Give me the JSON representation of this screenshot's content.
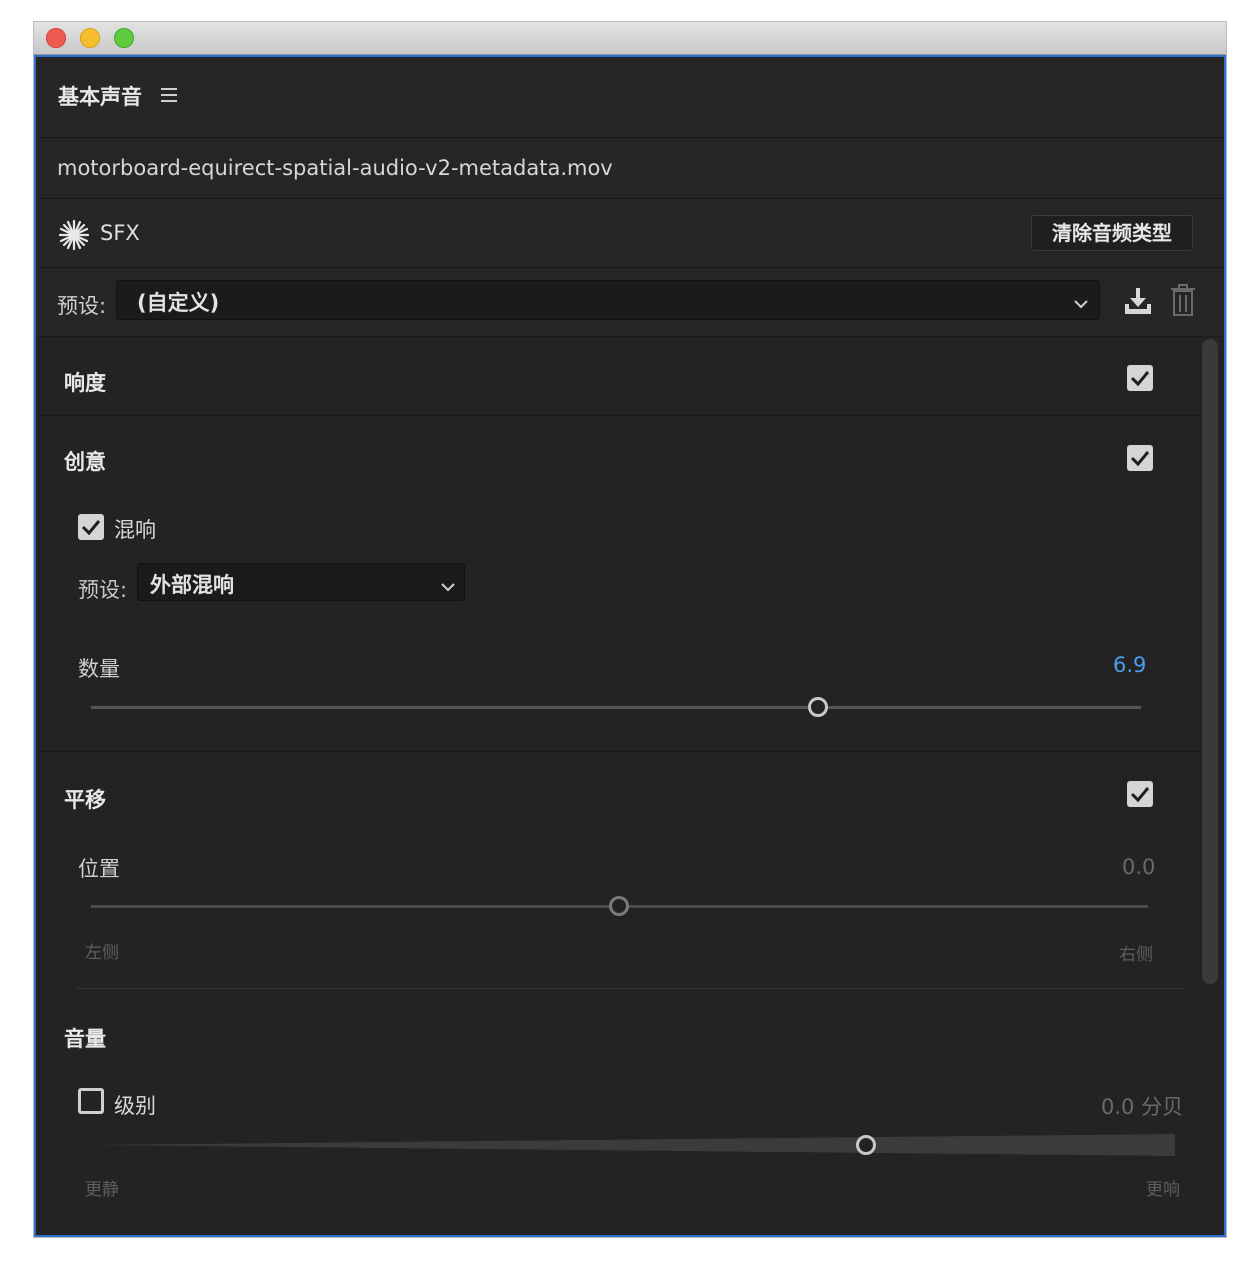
{
  "panel": {
    "title": "基本声音"
  },
  "clip": {
    "filename": "motorboard-equirect-spatial-audio-v2-metadata.mov"
  },
  "audio_type": {
    "label": "SFX",
    "clear_button": "清除音频类型"
  },
  "preset": {
    "label": "预设:",
    "value": "(自定义)"
  },
  "sections": {
    "loudness": {
      "title": "响度",
      "enabled": true
    },
    "creative": {
      "title": "创意",
      "enabled": true,
      "reverb_label": "混响",
      "reverb_checked": true,
      "preset_label": "预设:",
      "preset_value": "外部混响",
      "amount_label": "数量",
      "amount_value": "6.9"
    },
    "panning": {
      "title": "平移",
      "enabled": true,
      "position_label": "位置",
      "position_value": "0.0",
      "left_label": "左侧",
      "right_label": "右侧"
    },
    "volume": {
      "title": "音量",
      "level_label": "级别",
      "level_checked": false,
      "level_value": "0.0 分贝",
      "quieter_label": "更静",
      "louder_label": "更响"
    }
  },
  "colors": {
    "accent": "#4a9ff0",
    "focus_border": "#2d6fd0"
  }
}
